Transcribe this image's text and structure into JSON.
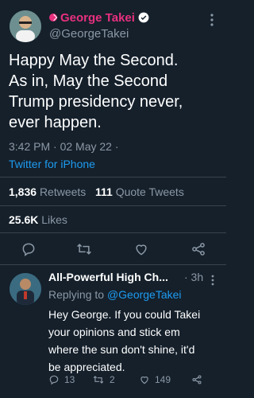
{
  "tweet": {
    "display_name": "George Takei",
    "handle": "@GeorgeTakei",
    "text_lines": [
      "Happy May the Second.",
      "As in, May the Second",
      "Trump presidency never,",
      "ever happen."
    ],
    "time": "3:42 PM · 02 May 22 ·",
    "source": "Twitter for iPhone",
    "retweets_count": "1,836",
    "retweets_label": "Retweets",
    "quote_count": "111",
    "quote_label": "Quote Tweets",
    "likes_count": "25.6K",
    "likes_label": "Likes"
  },
  "reply": {
    "display_name": "All-Powerful High Ch...",
    "time": "· 3h",
    "replying_prefix": "Replying to",
    "replying_handle": "@GeorgeTakei",
    "text_lines": [
      "Hey George. If you could Takei",
      "your opinions and stick em",
      "where the sun don't shine, it'd",
      "be appreciated."
    ],
    "reply_count": "13",
    "retweet_count": "2",
    "like_count": "149"
  },
  "colors": {
    "background": "#15202b",
    "accent_pink": "#e8307f",
    "link_blue": "#1d9bf0",
    "muted_gray": "#8b98a5"
  },
  "icons": [
    "reply-icon",
    "retweet-icon",
    "like-icon",
    "share-icon",
    "more-icon",
    "verified-icon"
  ]
}
